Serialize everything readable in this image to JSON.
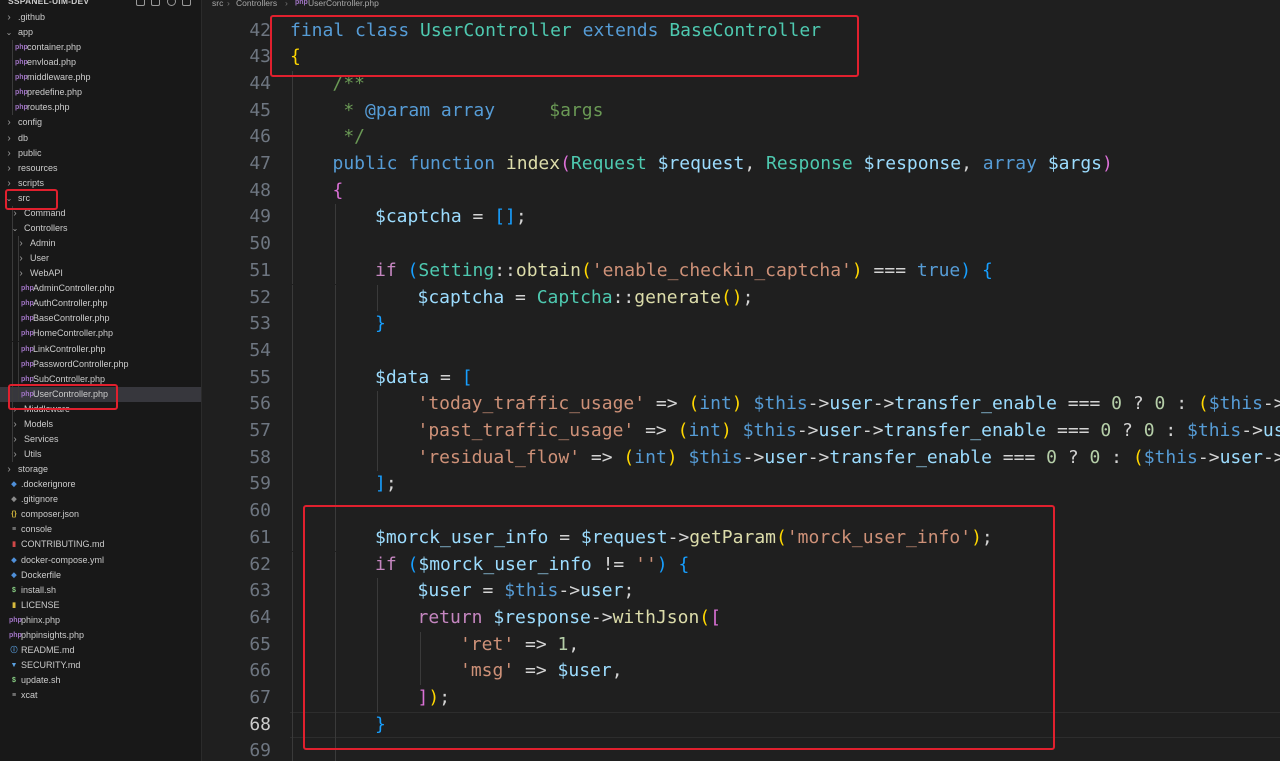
{
  "sidebar": {
    "title": "SSPANEL-UIM-DEV",
    "actions": [
      "new-file-icon",
      "new-folder-icon",
      "refresh-icon",
      "collapse-icon"
    ],
    "rows": [
      {
        "label": ".github",
        "type": "folder",
        "depth": 0,
        "open": false
      },
      {
        "label": "app",
        "type": "folder",
        "depth": 0,
        "open": true
      },
      {
        "label": "container.php",
        "type": "php",
        "depth": 1
      },
      {
        "label": "envload.php",
        "type": "php",
        "depth": 1
      },
      {
        "label": "middleware.php",
        "type": "php",
        "depth": 1
      },
      {
        "label": "predefine.php",
        "type": "php",
        "depth": 1
      },
      {
        "label": "routes.php",
        "type": "php",
        "depth": 1
      },
      {
        "label": "config",
        "type": "folder",
        "depth": 0,
        "open": false
      },
      {
        "label": "db",
        "type": "folder",
        "depth": 0,
        "open": false
      },
      {
        "label": "public",
        "type": "folder",
        "depth": 0,
        "open": false
      },
      {
        "label": "resources",
        "type": "folder",
        "depth": 0,
        "open": false
      },
      {
        "label": "scripts",
        "type": "folder",
        "depth": 0,
        "open": false
      },
      {
        "label": "src",
        "type": "folder",
        "depth": 0,
        "open": true,
        "highlight": true
      },
      {
        "label": "Command",
        "type": "folder",
        "depth": 1,
        "open": false
      },
      {
        "label": "Controllers",
        "type": "folder",
        "depth": 1,
        "open": true
      },
      {
        "label": "Admin",
        "type": "folder",
        "depth": 2,
        "open": false
      },
      {
        "label": "User",
        "type": "folder",
        "depth": 2,
        "open": false
      },
      {
        "label": "WebAPI",
        "type": "folder",
        "depth": 2,
        "open": false
      },
      {
        "label": "AdminController.php",
        "type": "php",
        "depth": 2
      },
      {
        "label": "AuthController.php",
        "type": "php",
        "depth": 2
      },
      {
        "label": "BaseController.php",
        "type": "php",
        "depth": 2
      },
      {
        "label": "HomeController.php",
        "type": "php",
        "depth": 2
      },
      {
        "label": "LinkController.php",
        "type": "php",
        "depth": 2
      },
      {
        "label": "PasswordController.php",
        "type": "php",
        "depth": 2
      },
      {
        "label": "SubController.php",
        "type": "php",
        "depth": 2
      },
      {
        "label": "UserController.php",
        "type": "php",
        "depth": 2,
        "selected": true,
        "highlight": true
      },
      {
        "label": "Middleware",
        "type": "folder",
        "depth": 1,
        "open": false
      },
      {
        "label": "Models",
        "type": "folder",
        "depth": 1,
        "open": false
      },
      {
        "label": "Services",
        "type": "folder",
        "depth": 1,
        "open": false
      },
      {
        "label": "Utils",
        "type": "folder",
        "depth": 1,
        "open": false
      },
      {
        "label": "storage",
        "type": "folder",
        "depth": 0,
        "open": false
      },
      {
        "label": ".dockerignore",
        "type": "docker",
        "depth": 0
      },
      {
        "label": ".gitignore",
        "type": "git",
        "depth": 0
      },
      {
        "label": "composer.json",
        "type": "json",
        "depth": 0
      },
      {
        "label": "console",
        "type": "text",
        "depth": 0
      },
      {
        "label": "CONTRIBUTING.md",
        "type": "md-red",
        "depth": 0
      },
      {
        "label": "docker-compose.yml",
        "type": "docker",
        "depth": 0
      },
      {
        "label": "Dockerfile",
        "type": "docker",
        "depth": 0
      },
      {
        "label": "install.sh",
        "type": "sh",
        "depth": 0
      },
      {
        "label": "LICENSE",
        "type": "license",
        "depth": 0
      },
      {
        "label": "phinx.php",
        "type": "php",
        "depth": 0
      },
      {
        "label": "phpinsights.php",
        "type": "php",
        "depth": 0
      },
      {
        "label": "README.md",
        "type": "info",
        "depth": 0
      },
      {
        "label": "SECURITY.md",
        "type": "security",
        "depth": 0
      },
      {
        "label": "update.sh",
        "type": "sh",
        "depth": 0
      },
      {
        "label": "xcat",
        "type": "text",
        "depth": 0
      }
    ]
  },
  "breadcrumb": [
    "src",
    "Controllers",
    "UserController.php"
  ],
  "editor": {
    "current_line": 68,
    "lines": [
      {
        "n": 42,
        "indent": 0,
        "t": [
          [
            "kw",
            "final class "
          ],
          [
            "cls",
            "UserController"
          ],
          [
            "kw",
            " extends "
          ],
          [
            "cls",
            "BaseController"
          ]
        ]
      },
      {
        "n": 43,
        "indent": 0,
        "t": [
          [
            "br1",
            "{"
          ]
        ]
      },
      {
        "n": 44,
        "indent": 1,
        "t": [
          [
            "cmt",
            "/**"
          ]
        ]
      },
      {
        "n": 45,
        "indent": 1,
        "t": [
          [
            "cmt",
            " * "
          ],
          [
            "kw",
            "@param"
          ],
          [
            "op",
            " "
          ],
          [
            "kw",
            "array"
          ],
          [
            "op",
            "     "
          ],
          [
            "cmt",
            "$args"
          ]
        ]
      },
      {
        "n": 46,
        "indent": 1,
        "t": [
          [
            "cmt",
            " */"
          ]
        ]
      },
      {
        "n": 47,
        "indent": 1,
        "t": [
          [
            "kw",
            "public function "
          ],
          [
            "fn",
            "index"
          ],
          [
            "br2",
            "("
          ],
          [
            "cls",
            "Request"
          ],
          [
            "op",
            " "
          ],
          [
            "var",
            "$request"
          ],
          [
            "op",
            ", "
          ],
          [
            "cls",
            "Response"
          ],
          [
            "op",
            " "
          ],
          [
            "var",
            "$response"
          ],
          [
            "op",
            ", "
          ],
          [
            "kw",
            "array"
          ],
          [
            "op",
            " "
          ],
          [
            "var",
            "$args"
          ],
          [
            "br2",
            ")"
          ]
        ]
      },
      {
        "n": 48,
        "indent": 1,
        "t": [
          [
            "br2",
            "{"
          ]
        ]
      },
      {
        "n": 49,
        "indent": 2,
        "t": [
          [
            "var",
            "$captcha"
          ],
          [
            "op",
            " = "
          ],
          [
            "br3",
            "[]"
          ],
          [
            "op",
            ";"
          ]
        ]
      },
      {
        "n": 50,
        "indent": 2,
        "t": []
      },
      {
        "n": 51,
        "indent": 2,
        "t": [
          [
            "kc",
            "if "
          ],
          [
            "br3",
            "("
          ],
          [
            "cls",
            "Setting"
          ],
          [
            "op",
            "::"
          ],
          [
            "fn",
            "obtain"
          ],
          [
            "br1",
            "("
          ],
          [
            "str",
            "'enable_checkin_captcha'"
          ],
          [
            "br1",
            ")"
          ],
          [
            "op",
            " === "
          ],
          [
            "kw",
            "true"
          ],
          [
            "br3",
            ")"
          ],
          [
            "op",
            " "
          ],
          [
            "br3",
            "{"
          ]
        ]
      },
      {
        "n": 52,
        "indent": 3,
        "t": [
          [
            "var",
            "$captcha"
          ],
          [
            "op",
            " = "
          ],
          [
            "cls",
            "Captcha"
          ],
          [
            "op",
            "::"
          ],
          [
            "fn",
            "generate"
          ],
          [
            "br1",
            "()"
          ],
          [
            "op",
            ";"
          ]
        ]
      },
      {
        "n": 53,
        "indent": 2,
        "t": [
          [
            "br3",
            "}"
          ]
        ]
      },
      {
        "n": 54,
        "indent": 2,
        "t": []
      },
      {
        "n": 55,
        "indent": 2,
        "t": [
          [
            "var",
            "$data"
          ],
          [
            "op",
            " = "
          ],
          [
            "br3",
            "["
          ]
        ]
      },
      {
        "n": 56,
        "indent": 3,
        "t": [
          [
            "str",
            "'today_traffic_usage'"
          ],
          [
            "op",
            " => "
          ],
          [
            "br1",
            "("
          ],
          [
            "kw",
            "int"
          ],
          [
            "br1",
            ")"
          ],
          [
            "op",
            " "
          ],
          [
            "kw",
            "$this"
          ],
          [
            "op",
            "->"
          ],
          [
            "var",
            "user"
          ],
          [
            "op",
            "->"
          ],
          [
            "var",
            "transfer_enable"
          ],
          [
            "op",
            " === "
          ],
          [
            "num",
            "0"
          ],
          [
            "op",
            " ? "
          ],
          [
            "num",
            "0"
          ],
          [
            "op",
            " : "
          ],
          [
            "br1",
            "("
          ],
          [
            "kw",
            "$this"
          ],
          [
            "op",
            "->"
          ],
          [
            "var",
            "u"
          ]
        ]
      },
      {
        "n": 57,
        "indent": 3,
        "t": [
          [
            "str",
            "'past_traffic_usage'"
          ],
          [
            "op",
            " => "
          ],
          [
            "br1",
            "("
          ],
          [
            "kw",
            "int"
          ],
          [
            "br1",
            ")"
          ],
          [
            "op",
            " "
          ],
          [
            "kw",
            "$this"
          ],
          [
            "op",
            "->"
          ],
          [
            "var",
            "user"
          ],
          [
            "op",
            "->"
          ],
          [
            "var",
            "transfer_enable"
          ],
          [
            "op",
            " === "
          ],
          [
            "num",
            "0"
          ],
          [
            "op",
            " ? "
          ],
          [
            "num",
            "0"
          ],
          [
            "op",
            " : "
          ],
          [
            "kw",
            "$this"
          ],
          [
            "op",
            "->"
          ],
          [
            "var",
            "use"
          ]
        ]
      },
      {
        "n": 58,
        "indent": 3,
        "t": [
          [
            "str",
            "'residual_flow'"
          ],
          [
            "op",
            " => "
          ],
          [
            "br1",
            "("
          ],
          [
            "kw",
            "int"
          ],
          [
            "br1",
            ")"
          ],
          [
            "op",
            " "
          ],
          [
            "kw",
            "$this"
          ],
          [
            "op",
            "->"
          ],
          [
            "var",
            "user"
          ],
          [
            "op",
            "->"
          ],
          [
            "var",
            "transfer_enable"
          ],
          [
            "op",
            " === "
          ],
          [
            "num",
            "0"
          ],
          [
            "op",
            " ? "
          ],
          [
            "num",
            "0"
          ],
          [
            "op",
            " : "
          ],
          [
            "br1",
            "("
          ],
          [
            "kw",
            "$this"
          ],
          [
            "op",
            "->"
          ],
          [
            "var",
            "user"
          ],
          [
            "op",
            "->"
          ],
          [
            "var",
            "t"
          ]
        ]
      },
      {
        "n": 59,
        "indent": 2,
        "t": [
          [
            "br3",
            "]"
          ],
          [
            "op",
            ";"
          ]
        ]
      },
      {
        "n": 60,
        "indent": 2,
        "t": []
      },
      {
        "n": 61,
        "indent": 2,
        "t": [
          [
            "var",
            "$morck_user_info"
          ],
          [
            "op",
            " = "
          ],
          [
            "var",
            "$request"
          ],
          [
            "op",
            "->"
          ],
          [
            "fn",
            "getParam"
          ],
          [
            "br1",
            "("
          ],
          [
            "str",
            "'morck_user_info'"
          ],
          [
            "br1",
            ")"
          ],
          [
            "op",
            ";"
          ]
        ]
      },
      {
        "n": 62,
        "indent": 2,
        "t": [
          [
            "kc",
            "if "
          ],
          [
            "br3",
            "("
          ],
          [
            "var",
            "$morck_user_info"
          ],
          [
            "op",
            " != "
          ],
          [
            "str",
            "''"
          ],
          [
            "br3",
            ")"
          ],
          [
            "op",
            " "
          ],
          [
            "br3",
            "{"
          ]
        ]
      },
      {
        "n": 63,
        "indent": 3,
        "t": [
          [
            "var",
            "$user"
          ],
          [
            "op",
            " = "
          ],
          [
            "kw",
            "$this"
          ],
          [
            "op",
            "->"
          ],
          [
            "var",
            "user"
          ],
          [
            "op",
            ";"
          ]
        ]
      },
      {
        "n": 64,
        "indent": 3,
        "t": [
          [
            "kc",
            "return "
          ],
          [
            "var",
            "$response"
          ],
          [
            "op",
            "->"
          ],
          [
            "fn",
            "withJson"
          ],
          [
            "br1",
            "("
          ],
          [
            "br2",
            "["
          ]
        ]
      },
      {
        "n": 65,
        "indent": 4,
        "t": [
          [
            "str",
            "'ret'"
          ],
          [
            "op",
            " => "
          ],
          [
            "num",
            "1"
          ],
          [
            "op",
            ","
          ]
        ]
      },
      {
        "n": 66,
        "indent": 4,
        "t": [
          [
            "str",
            "'msg'"
          ],
          [
            "op",
            " => "
          ],
          [
            "var",
            "$user"
          ],
          [
            "op",
            ","
          ]
        ]
      },
      {
        "n": 67,
        "indent": 3,
        "t": [
          [
            "br2",
            "]"
          ],
          [
            "br1",
            ")"
          ],
          [
            "op",
            ";"
          ]
        ]
      },
      {
        "n": 68,
        "indent": 2,
        "t": [
          [
            "br3",
            "}"
          ]
        ]
      },
      {
        "n": 69,
        "indent": 2,
        "t": []
      }
    ]
  },
  "colors": {
    "highlight_box": "#e0202e",
    "editor_bg": "#1f1f1f",
    "sidebar_bg": "#181818",
    "selected_row": "#37373d"
  }
}
